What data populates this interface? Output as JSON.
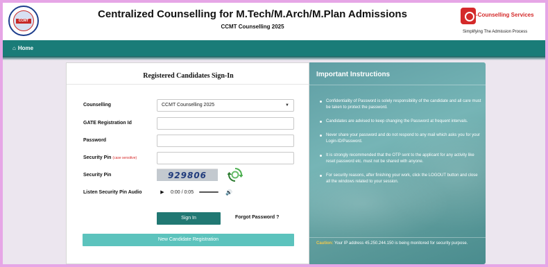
{
  "header": {
    "title": "Centralized Counselling for M.Tech/M.Arch/M.Plan Admissions",
    "subtitle": "CCMT Counselling 2025",
    "left_logo_text": "CCMT",
    "brand_name": "-Counselling Services",
    "brand_tagline": "Simplifying The Admission Process"
  },
  "nav": {
    "home_label": "Home",
    "home_icon": "home-icon"
  },
  "signin": {
    "title": "Registered Candidates Sign-In",
    "fields": {
      "counselling_label": "Counselling",
      "counselling_value": "CCMT Counselling 2025",
      "gate_label": "GATE Registration Id",
      "gate_value": "",
      "password_label": "Password",
      "password_value": "",
      "security_pin_label": "Security Pin",
      "security_pin_note": "(case sensitive)",
      "security_pin_value": "",
      "captcha_label": "Security Pin",
      "captcha_value": "929806",
      "audio_label": "Listen Security Pin Audio",
      "audio_time": "0:00 / 0:05"
    },
    "buttons": {
      "signin": "Sign In",
      "forgot": "Forgot Password ?",
      "register": "New Candidate Registration"
    }
  },
  "instructions": {
    "title": "Important Instructions",
    "items": [
      "Confidentiality of Password is solely responsibility of the candidate and all care must be taken to protect the password.",
      "Candidates are advised to keep changing the Password at frequent intervals.",
      "Never share your password and do not respond to any mail which asks you for your Login-ID/Password.",
      "It is strongly recommended that the OTP sent to the applicant for any activity like reset password etc. must not be shared with anyone.",
      "For security reasons, after finishing your work, click the LOGOUT button and close all the windows related to your session."
    ],
    "caution_label": "Caution:",
    "caution_text": " Your IP address 45.250.244.150 is being monitored for security purpose."
  },
  "colors": {
    "nav": "#1a7c78",
    "signin_button": "#217873",
    "register_button": "#5cc3bd",
    "border": "#e6a6e6",
    "caution": "#f2c94c"
  }
}
